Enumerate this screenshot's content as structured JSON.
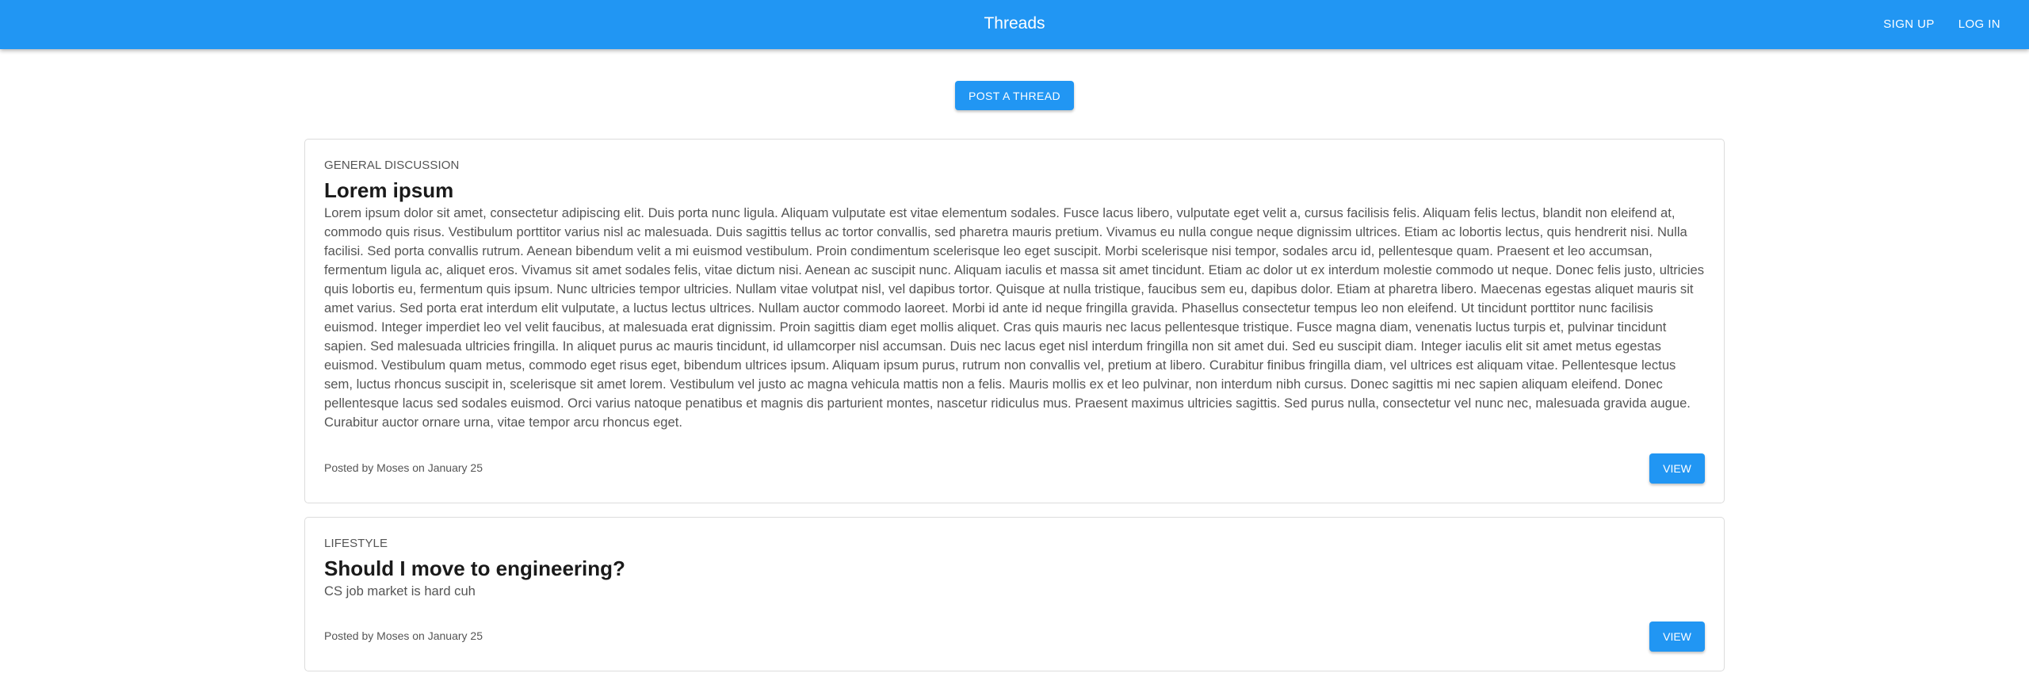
{
  "header": {
    "title": "Threads",
    "sign_up": "SIGN UP",
    "log_in": "LOG IN"
  },
  "post_button": "POST A THREAD",
  "colors": {
    "primary": "#2196f3"
  },
  "threads": [
    {
      "category": "GENERAL DISCUSSION",
      "title": "Lorem ipsum",
      "body": "Lorem ipsum dolor sit amet, consectetur adipiscing elit. Duis porta nunc ligula. Aliquam vulputate est vitae elementum sodales. Fusce lacus libero, vulputate eget velit a, cursus facilisis felis. Aliquam felis lectus, blandit non eleifend at, commodo quis risus. Vestibulum porttitor varius nisl ac malesuada. Duis sagittis tellus ac tortor convallis, sed pharetra mauris pretium. Vivamus eu nulla congue neque dignissim ultrices. Etiam ac lobortis lectus, quis hendrerit nisi. Nulla facilisi. Sed porta convallis rutrum. Aenean bibendum velit a mi euismod vestibulum. Proin condimentum scelerisque leo eget suscipit. Morbi scelerisque nisi tempor, sodales arcu id, pellentesque quam. Praesent et leo accumsan, fermentum ligula ac, aliquet eros. Vivamus sit amet sodales felis, vitae dictum nisi. Aenean ac suscipit nunc. Aliquam iaculis et massa sit amet tincidunt. Etiam ac dolor ut ex interdum molestie commodo ut neque. Donec felis justo, ultricies quis lobortis eu, fermentum quis ipsum. Nunc ultricies tempor ultricies. Nullam vitae volutpat nisl, vel dapibus tortor. Quisque at nulla tristique, faucibus sem eu, dapibus dolor. Etiam at pharetra libero. Maecenas egestas aliquet mauris sit amet varius. Sed porta erat interdum elit vulputate, a luctus lectus ultrices. Nullam auctor commodo laoreet. Morbi id ante id neque fringilla gravida. Phasellus consectetur tempus leo non eleifend. Ut tincidunt porttitor nunc facilisis euismod. Integer imperdiet leo vel velit faucibus, at malesuada erat dignissim. Proin sagittis diam eget mollis aliquet. Cras quis mauris nec lacus pellentesque tristique. Fusce magna diam, venenatis luctus turpis et, pulvinar tincidunt sapien. Sed malesuada ultricies fringilla. In aliquet purus ac mauris tincidunt, id ullamcorper nisl accumsan. Duis nec lacus eget nisl interdum fringilla non sit amet dui. Sed eu suscipit diam. Integer iaculis elit sit amet metus egestas euismod. Vestibulum quam metus, commodo eget risus eget, bibendum ultrices ipsum. Aliquam ipsum purus, rutrum non convallis vel, pretium at libero. Curabitur finibus fringilla diam, vel ultrices est aliquam vitae. Pellentesque lectus sem, luctus rhoncus suscipit in, scelerisque sit amet lorem. Vestibulum vel justo ac magna vehicula mattis non a felis. Mauris mollis ex et leo pulvinar, non interdum nibh cursus. Donec sagittis mi nec sapien aliquam eleifend. Donec pellentesque lacus sed sodales euismod. Orci varius natoque penatibus et magnis dis parturient montes, nascetur ridiculus mus. Praesent maximus ultricies sagittis. Sed purus nulla, consectetur vel nunc nec, malesuada gravida augue. Curabitur auctor ornare urna, vitae tempor arcu rhoncus eget.",
      "posted": "Posted by Moses on January 25",
      "view": "VIEW"
    },
    {
      "category": "LIFESTYLE",
      "title": "Should I move to engineering?",
      "body": "CS job market is hard cuh",
      "posted": "Posted by Moses on January 25",
      "view": "VIEW"
    }
  ]
}
